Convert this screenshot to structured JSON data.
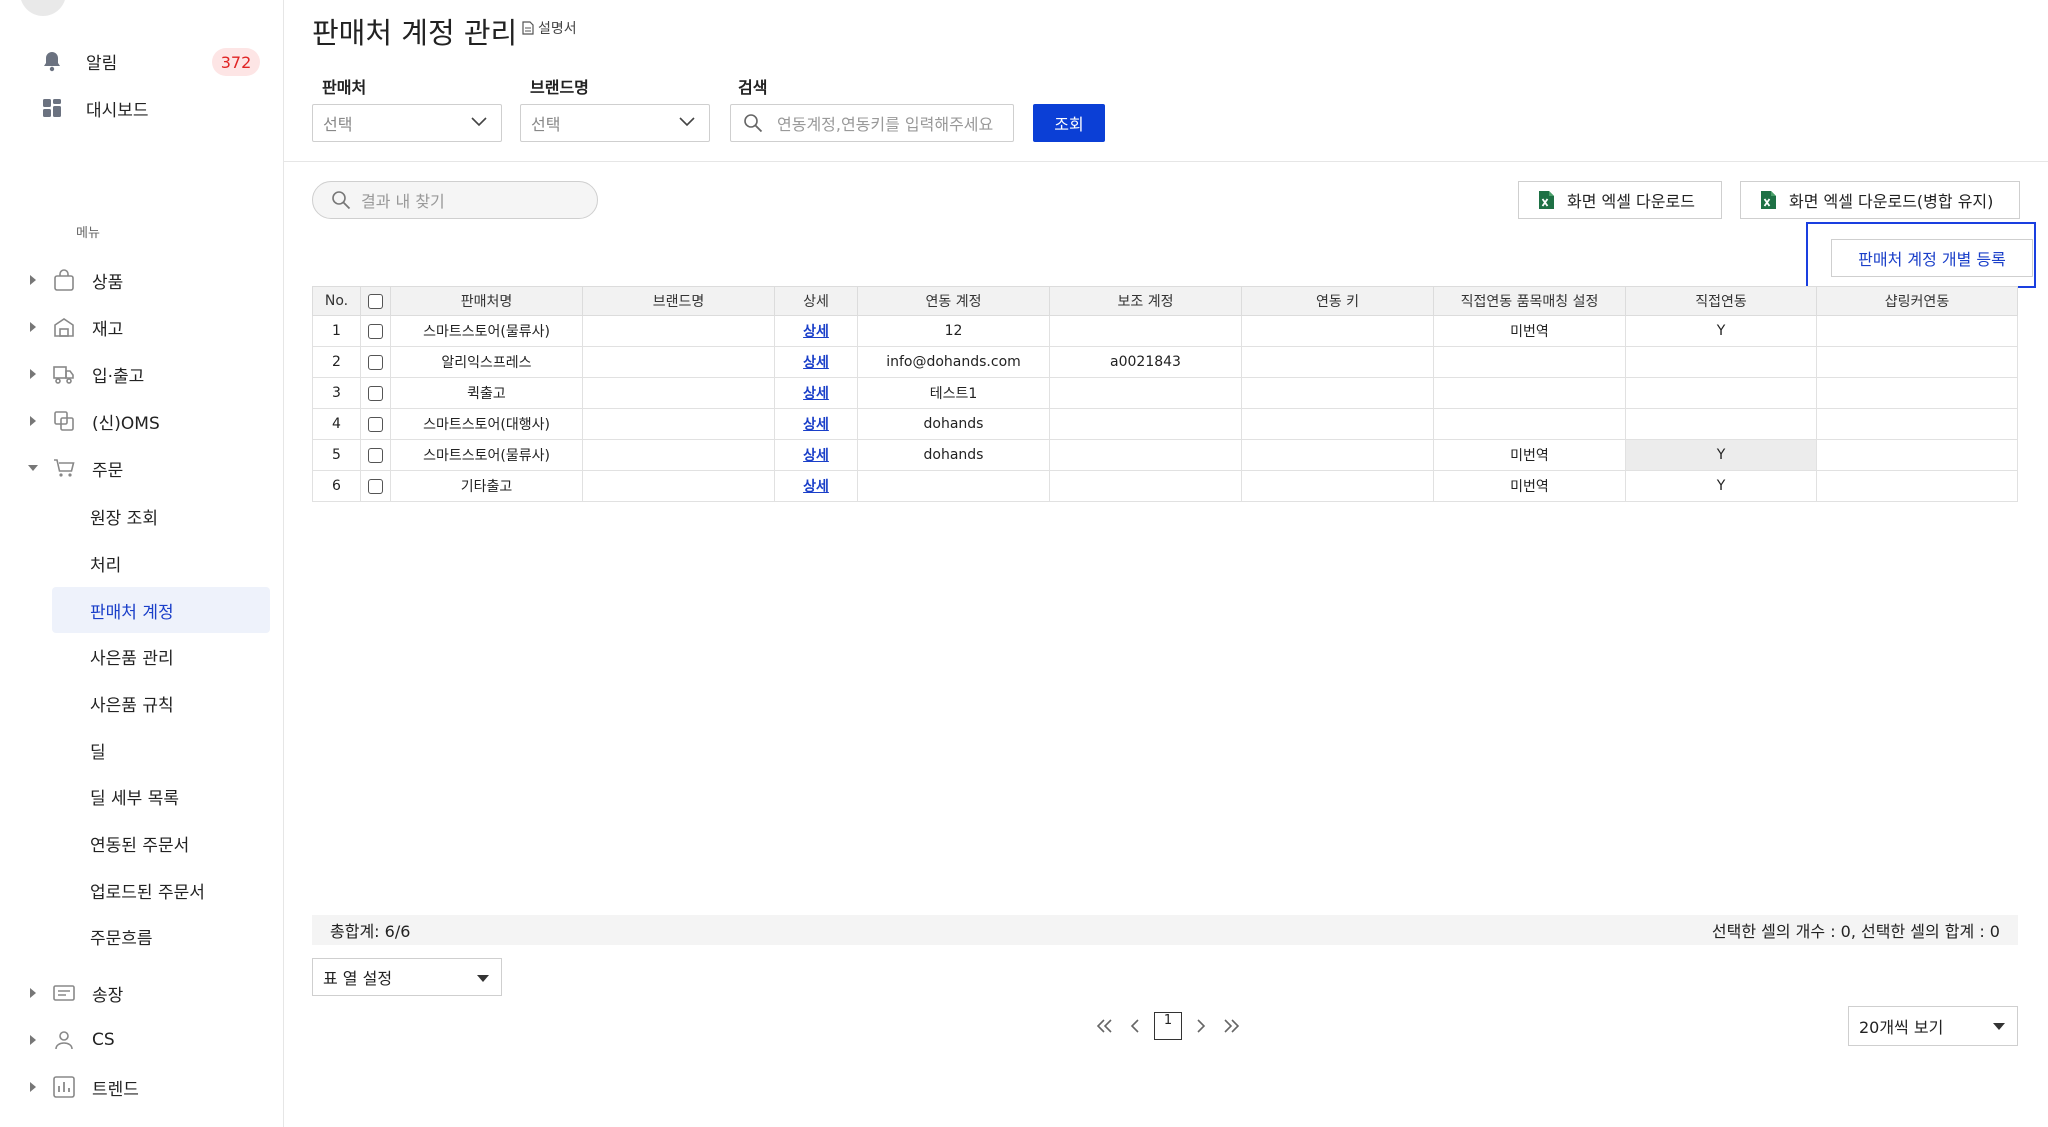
{
  "sidebar": {
    "alarm_label": "알림",
    "alarm_count": "372",
    "dashboard_label": "대시보드",
    "menu_heading": "메뉴",
    "categories": [
      {
        "label": "상품"
      },
      {
        "label": "재고"
      },
      {
        "label": "입·출고"
      },
      {
        "label": "(신)OMS"
      },
      {
        "label": "주문"
      },
      {
        "label": "송장"
      },
      {
        "label": "CS"
      },
      {
        "label": "트렌드"
      }
    ],
    "order_subitems": [
      {
        "label": "원장 조회"
      },
      {
        "label": "처리"
      },
      {
        "label": "판매처 계정"
      },
      {
        "label": "사은품 관리"
      },
      {
        "label": "사은품 규칙"
      },
      {
        "label": "딜"
      },
      {
        "label": "딜 세부 목록"
      },
      {
        "label": "연동된 주문서"
      },
      {
        "label": "업로드된 주문서"
      },
      {
        "label": "주문흐름"
      }
    ]
  },
  "header": {
    "title": "판매처 계정 관리",
    "manual_label": "설명서"
  },
  "filters": {
    "seller_label": "판매처",
    "seller_value": "선택",
    "brand_label": "브랜드명",
    "brand_value": "선택",
    "search_label": "검색",
    "search_placeholder": "연동계정,연동키를 입력해주세요",
    "query_button": "조회"
  },
  "toolbar": {
    "result_search_placeholder": "결과 내 찾기",
    "excel_download": "화면 엑셀 다운로드",
    "excel_download_merge": "화면 엑셀 다운로드(병합 유지)",
    "register_button": "판매처 계정 개별 등록"
  },
  "table": {
    "headers": [
      "No.",
      "",
      "판매처명",
      "브랜드명",
      "상세",
      "연동 계정",
      "보조 계정",
      "연동 키",
      "직접연동 품목매칭 설정",
      "직접연동",
      "샵링커연동"
    ],
    "rows": [
      {
        "no": "1",
        "seller": "스마트스토어(물류사)",
        "brand": "",
        "detail": "상세",
        "account": "12",
        "sub_account": "",
        "key": "",
        "matching": "미번역",
        "direct": "Y",
        "shoplinker": ""
      },
      {
        "no": "2",
        "seller": "알리익스프레스",
        "brand": "",
        "detail": "상세",
        "account": "info@dohands.com",
        "sub_account": "a0021843",
        "key": "",
        "matching": "",
        "direct": "",
        "shoplinker": ""
      },
      {
        "no": "3",
        "seller": "퀵출고",
        "brand": "",
        "detail": "상세",
        "account": "테스트1",
        "sub_account": "",
        "key": "",
        "matching": "",
        "direct": "",
        "shoplinker": ""
      },
      {
        "no": "4",
        "seller": "스마트스토어(대행사)",
        "brand": "",
        "detail": "상세",
        "account": "dohands",
        "sub_account": "",
        "key": "",
        "matching": "",
        "direct": "",
        "shoplinker": ""
      },
      {
        "no": "5",
        "seller": "스마트스토어(물류사)",
        "brand": "",
        "detail": "상세",
        "account": "dohands",
        "sub_account": "",
        "key": "",
        "matching": "미번역",
        "direct": "Y",
        "shoplinker": ""
      },
      {
        "no": "6",
        "seller": "기타출고",
        "brand": "",
        "detail": "상세",
        "account": "",
        "sub_account": "",
        "key": "",
        "matching": "미번역",
        "direct": "Y",
        "shoplinker": ""
      }
    ]
  },
  "footer": {
    "total": "총합계: 6/6",
    "selection_info": "선택한 셀의 개수 : 0, 선택한 셀의 합계 : 0",
    "column_setting": "표 열 설정",
    "current_page": "1",
    "page_size": "20개씩 보기"
  },
  "colors": {
    "accent": "#0b3fd6",
    "badge_text": "#e02424",
    "badge_bg": "#fde5e5",
    "active_bg": "#eef2fb",
    "excel_green": "#1e7145"
  }
}
